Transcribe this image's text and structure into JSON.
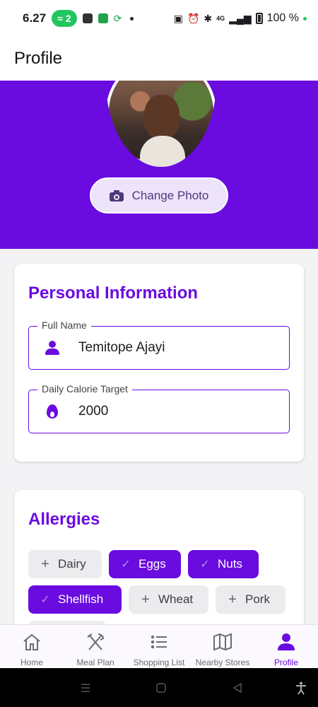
{
  "status_bar": {
    "time": "6.27",
    "hotspot_count": "2",
    "battery": "100 %",
    "network": "4G"
  },
  "app_bar": {
    "title": "Profile"
  },
  "header": {
    "avatar_alt": "profile-photo",
    "change_photo_label": "Change Photo",
    "background_color": "#6a0be0"
  },
  "personal_info": {
    "title": "Personal Information",
    "full_name": {
      "label": "Full Name",
      "value": "Temitope Ajayi"
    },
    "calorie_target": {
      "label": "Daily Calorie Target",
      "value": "2000"
    }
  },
  "allergies": {
    "title": "Allergies",
    "chips": [
      {
        "label": "Dairy",
        "selected": false
      },
      {
        "label": "Eggs",
        "selected": true
      },
      {
        "label": "Nuts",
        "selected": true
      },
      {
        "label": "Shellfish",
        "selected": true
      },
      {
        "label": "Wheat",
        "selected": false
      },
      {
        "label": "Pork",
        "selected": false
      }
    ]
  },
  "bottom_nav": {
    "items": [
      {
        "label": "Home",
        "icon": "home-icon",
        "active": false
      },
      {
        "label": "Meal Plan",
        "icon": "utensils-icon",
        "active": false
      },
      {
        "label": "Shopping List",
        "icon": "list-icon",
        "active": false
      },
      {
        "label": "Nearby Stores",
        "icon": "map-icon",
        "active": false
      },
      {
        "label": "Profile",
        "icon": "person-icon",
        "active": true
      }
    ]
  },
  "colors": {
    "accent": "#6a0be0",
    "chip_inactive": "#ececee",
    "nav_inactive": "#6b6b72"
  }
}
